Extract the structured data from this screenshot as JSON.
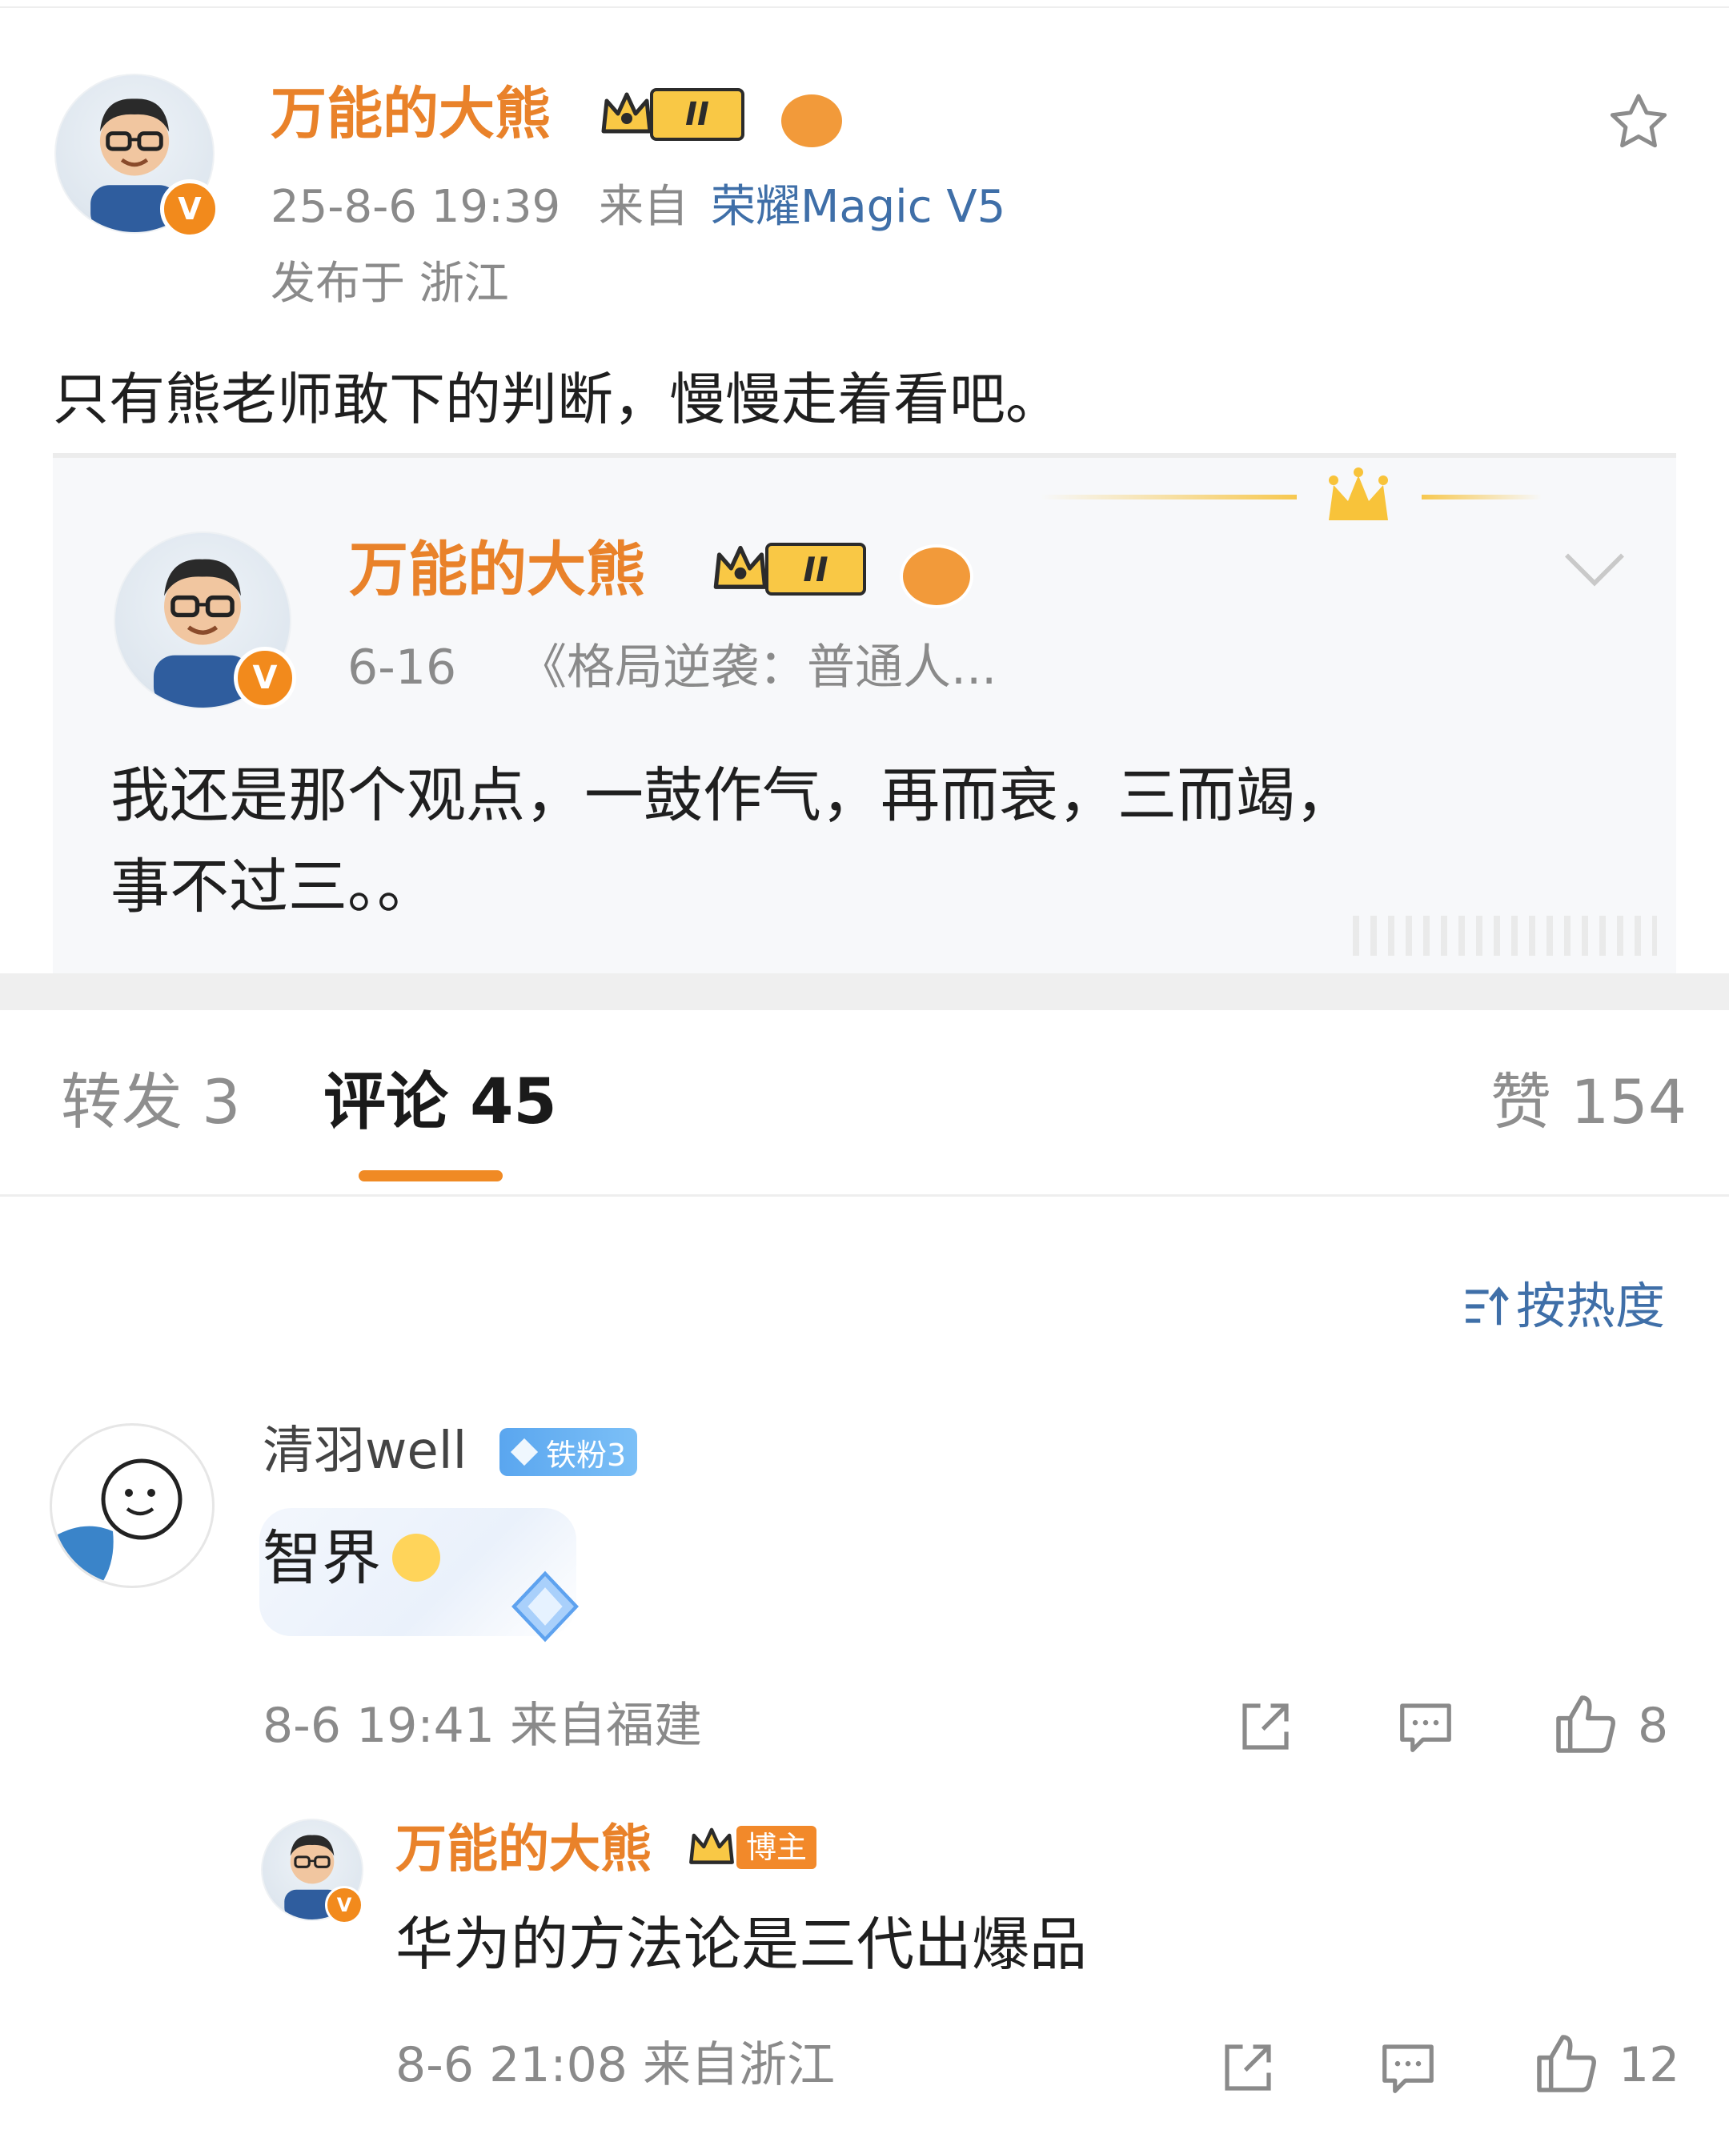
{
  "post": {
    "author": "万能的大熊",
    "level_badge": "II",
    "timestamp": "25-8-6 19:39",
    "source_prefix": "来自",
    "source_device": "荣耀Magic V5",
    "location": "发布于 浙江",
    "content": "只有熊老师敢下的判断，慢慢走着看吧。"
  },
  "quoted_post": {
    "author": "万能的大熊",
    "level_badge": "II",
    "date": "6-16",
    "title": "《格局逆袭：普通人...",
    "content_line1": "我还是那个观点，一鼓作气，再而衰，三而竭，",
    "content_line2": "事不过三。。"
  },
  "tabs": {
    "repost": "转发 3",
    "comments": "评论 45",
    "likes": "赞 154"
  },
  "sort": {
    "label": "按热度"
  },
  "comments": [
    {
      "user": "清羽well",
      "fan_badge": "铁粉3",
      "text": "智界",
      "time_location": "8-6 19:41 来自福建",
      "like_count": "8",
      "reply": {
        "user": "万能的大熊",
        "role_badge": "博主",
        "text": "华为的方法论是三代出爆品",
        "time_location": "8-6 21:08 来自浙江",
        "like_count": "12"
      }
    }
  ],
  "colors": {
    "orange_name": "#e9822a",
    "accent_underline": "#f08a24",
    "link_blue": "#3f6fa8",
    "grey_text": "#8a8a8a"
  },
  "icons": [
    "star-icon",
    "chevron-down-icon",
    "sort-icon",
    "share-icon",
    "comment-icon",
    "like-icon"
  ]
}
